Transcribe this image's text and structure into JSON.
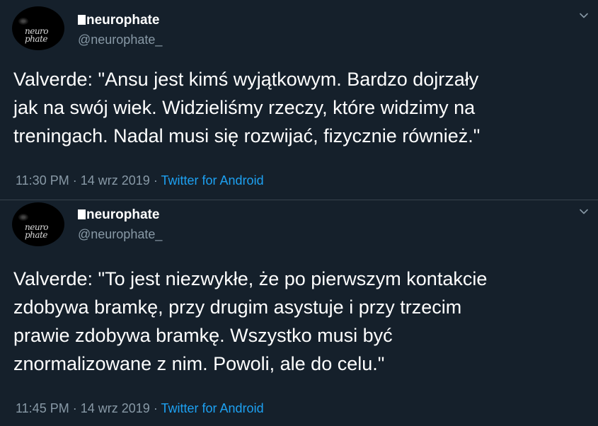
{
  "tweets": [
    {
      "display_name": "neurophate",
      "handle": "@neurophate_",
      "avatar_text": "neuro\nphate",
      "text": "Valverde: \"Ansu jest kimś wyjątkowym. Bardzo dojrzały\njak na swój wiek. Widzieliśmy rzeczy, które widzimy na\ntreningach. Nadal musi się rozwijać, fizycznie również.\"",
      "time": "11:30 PM",
      "date": "14 wrz 2019",
      "sep": "·",
      "source": "Twitter for Android"
    },
    {
      "display_name": "neurophate",
      "handle": "@neurophate_",
      "avatar_text": "neuro\nphate",
      "text": "Valverde: \"To jest niezwykłe, że po pierwszym kontakcie\nzdobywa bramkę, przy drugim asystuje i przy trzecim\nprawie zdobywa bramkę. Wszystko musi być\nznormalizowane z nim. Powoli, ale do celu.\"",
      "time": "11:45 PM",
      "date": "14 wrz 2019",
      "sep": "·",
      "source": "Twitter for Android"
    }
  ],
  "icons": {
    "more": "chevron-down-icon"
  },
  "colors": {
    "background": "#15202b",
    "text": "#ffffff",
    "secondary": "#8899a6",
    "link": "#1da1f2",
    "divider": "#38444d"
  }
}
